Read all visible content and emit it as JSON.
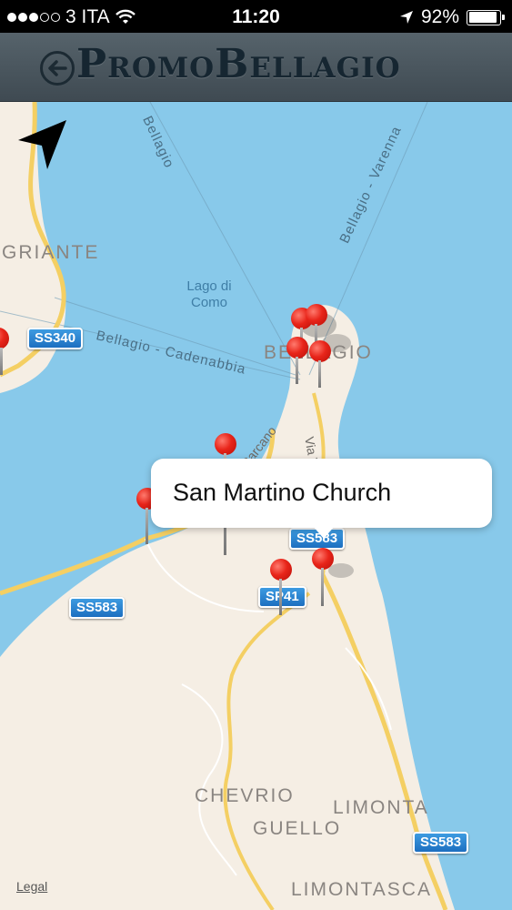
{
  "status_bar": {
    "carrier": "3 ITA",
    "time": "11:20",
    "battery": "92%",
    "battery_level": 0.92,
    "signal_dots_filled": 3,
    "signal_dots_total": 5
  },
  "header": {
    "title": "PromoBellagio"
  },
  "map": {
    "water_label": "Lago di Como",
    "towns": [
      "GRIANTE",
      "BELLAGIO",
      "CHEVRIO",
      "GUELLO",
      "LIMONTA",
      "LIMONTASCA"
    ],
    "ferry_routes": [
      "Bellagio - Cadenabbia",
      "Bellagio - Varenna",
      "Bellagio"
    ],
    "roads": [
      "Carcano",
      "Via V"
    ],
    "shields": [
      "SS340",
      "SS583",
      "SS583",
      "SP41",
      "SS583"
    ],
    "legal": "Legal",
    "colors": {
      "water": "#88c9ea",
      "land": "#f5eee4",
      "road": "#f4cf63",
      "pin": "#e8251a",
      "shield": "#2a84d2"
    }
  },
  "callout": {
    "title": "San Martino Church"
  }
}
